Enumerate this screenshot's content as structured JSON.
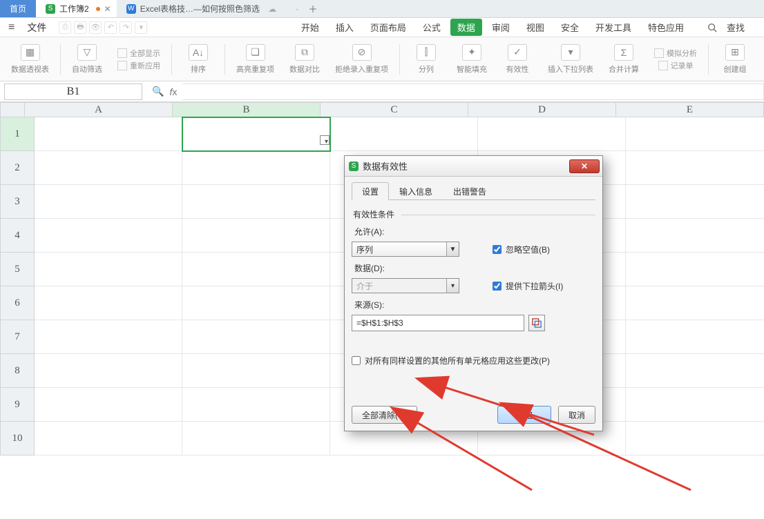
{
  "tabs": {
    "home": "首页",
    "doc_name": "工作簿2",
    "other_name": "Excel表格技…—如何按照色筛选"
  },
  "menubar": {
    "file": "文件",
    "items": [
      "开始",
      "插入",
      "页面布局",
      "公式",
      "数据",
      "审阅",
      "视图",
      "安全",
      "开发工具",
      "特色应用"
    ],
    "active_index": 4,
    "search_label": "查找"
  },
  "ribbon": {
    "g0": "数据透视表",
    "g1": "自动筛选",
    "g1a": "全部显示",
    "g1b": "重新应用",
    "g2": "排序",
    "g3": "高亮重复项",
    "g4": "数据对比",
    "g5": "拒绝录入重复项",
    "g6": "分列",
    "g7": "智能填充",
    "g8": "有效性",
    "g9": "插入下拉列表",
    "g10": "合并计算",
    "g11a": "模拟分析",
    "g11b": "记录单",
    "g12": "创建组"
  },
  "namebox": "B1",
  "columns": [
    "A",
    "B",
    "C",
    "D",
    "E"
  ],
  "rows": [
    "1",
    "2",
    "3",
    "4",
    "5",
    "6",
    "7",
    "8",
    "9",
    "10"
  ],
  "dialog": {
    "title": "数据有效性",
    "tabs": [
      "设置",
      "输入信息",
      "出错警告"
    ],
    "active_tab": 0,
    "fieldset": "有效性条件",
    "allow_label": "允许(A):",
    "allow_value": "序列",
    "data_label": "数据(D):",
    "data_value": "介于",
    "ignore_blank": "忽略空值(B)",
    "dropdown_arrow": "提供下拉箭头(I)",
    "source_label": "来源(S):",
    "source_value": "=$H$1:$H$3",
    "apply_all": "对所有同样设置的其他所有单元格应用这些更改(P)",
    "btn_clear": "全部清除(C)",
    "btn_ok": "确定",
    "btn_cancel": "取消"
  }
}
